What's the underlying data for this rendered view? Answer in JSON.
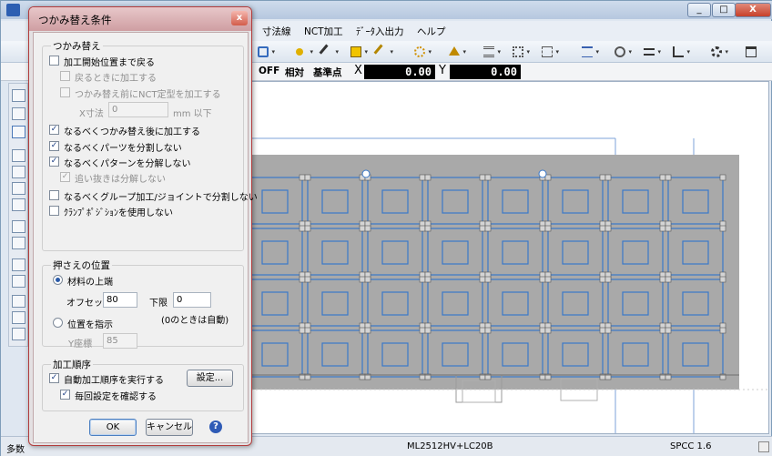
{
  "app": {
    "menus": [
      "寸法線",
      "NCT加工",
      "ﾃﾞｰﾀ入出力",
      "ヘルプ"
    ],
    "window_buttons": [
      "_",
      "□",
      "X"
    ],
    "coord": {
      "off": "OFF",
      "relative": "相対",
      "origin": "基準点",
      "x_label": "X",
      "x_value": "0.00",
      "y_label": "Y",
      "y_value": "0.00"
    },
    "status": {
      "left": "多数",
      "machine": "ML2512HV+LC20B",
      "material": "SPCC 1.6"
    }
  },
  "dialog": {
    "title": "つかみ替え条件",
    "close": "x",
    "regrip_group": {
      "label": "つかみ替え",
      "start_at_machining": {
        "label": "加工開始位置まで戻る",
        "checked": false
      },
      "machine_on_return": {
        "label": "戻るときに加工する",
        "checked": false
      },
      "nct_shape_before": {
        "label": "つかみ替え前にNCT定型を加工する",
        "checked": false
      },
      "x_size_label": "X寸法",
      "x_size_value": "0",
      "x_size_unit": "mm 以下",
      "after_regrip": {
        "label": "なるべくつかみ替え後に加工する",
        "checked": true
      },
      "no_split_parts": {
        "label": "なるべくパーツを分割しない",
        "checked": true
      },
      "no_split_pattern": {
        "label": "なるべくパターンを分解しない",
        "checked": true
      },
      "no_split_extra": {
        "label": "追い抜きは分解しない",
        "checked": true
      },
      "no_split_group": {
        "label": "なるべくグループ加工/ジョイントで分割しない",
        "checked": false
      },
      "no_clamp_position": {
        "label": "ｸﾗﾝﾌﾟﾎﾟｼﾞｼｮﾝを使用しない",
        "checked": false
      }
    },
    "press_group": {
      "label": "押さえの位置",
      "top_edge": {
        "label": "材料の上端",
        "selected": true
      },
      "offset_label": "オフセット",
      "offset_value": "80",
      "lower_label": "下限",
      "lower_value": "0",
      "auto_note": "(0のときは自動)",
      "specify": {
        "label": "位置を指示",
        "selected": false
      },
      "y_coord_label": "Y座標",
      "y_coord_value": "85"
    },
    "order_group": {
      "label": "加工順序",
      "auto_order": {
        "label": "自動加工順序を実行する",
        "checked": true
      },
      "settings_button": "設定...",
      "confirm_each": {
        "label": "毎回設定を確認する",
        "checked": true
      }
    },
    "ok_button": "OK",
    "cancel_button": "キャンセル",
    "help_button": "?"
  },
  "colors": {
    "part_outline": "#3a78c9",
    "sheet_fill": "#a9a9a9",
    "dialog_border": "#b23c3c"
  }
}
